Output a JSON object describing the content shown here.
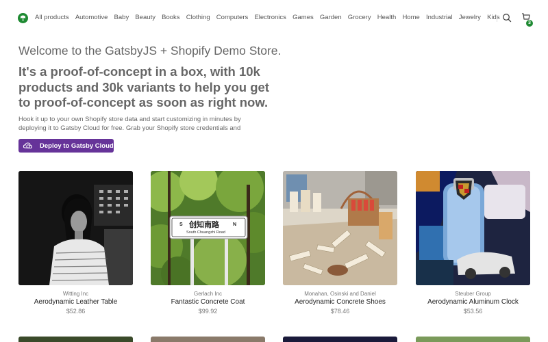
{
  "nav": {
    "items": [
      "All products",
      "Automotive",
      "Baby",
      "Beauty",
      "Books",
      "Clothing",
      "Computers",
      "Electronics",
      "Games",
      "Garden",
      "Grocery",
      "Health",
      "Home",
      "Industrial",
      "Jewelry",
      "Kids"
    ],
    "cart_count": "3",
    "brand_color": "#1e8a32"
  },
  "hero": {
    "welcome": "Welcome to the GatsbyJS + Shopify Demo Store.",
    "headline": "It's a proof-of-concept in a box, with 10k products and 30k variants to help you get to proof-of-concept as soon as right now.",
    "blurb": "Hook it up to your own Shopify store data and start customizing in minutes by deploying it to Gatsby Cloud for free. Grab your Shopify store credentials and",
    "deploy_label": "Deploy to Gatsby Cloud",
    "deploy_color": "#663399"
  },
  "products": [
    {
      "vendor": "Witting Inc",
      "title": "Aerodynamic Leather Table",
      "price": "$52.86"
    },
    {
      "vendor": "Gerlach Inc",
      "title": "Fantastic Concrete Coat",
      "price": "$99.92"
    },
    {
      "vendor": "Monahan, Osinski and Daniel",
      "title": "Aerodynamic Concrete Shoes",
      "price": "$78.46"
    },
    {
      "vendor": "Steuber Group",
      "title": "Aerodynamic Aluminum Clock",
      "price": "$53.56"
    }
  ],
  "images": {
    "sign_top": "创知南路",
    "sign_bottom": "South Chuangzhi Road",
    "sign_left": "S",
    "sign_right": "N"
  }
}
